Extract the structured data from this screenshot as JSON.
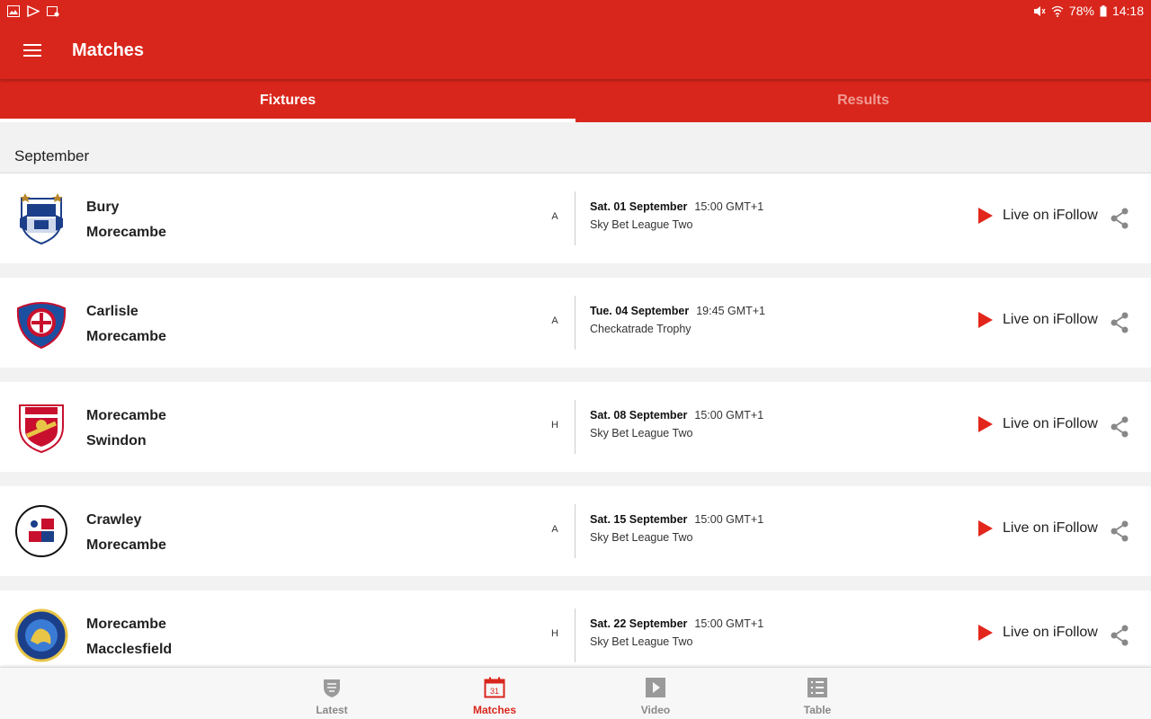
{
  "status_bar": {
    "battery": "78%",
    "time": "14:18"
  },
  "app_bar": {
    "title": "Matches"
  },
  "tabs": [
    {
      "label": "Fixtures",
      "active": true
    },
    {
      "label": "Results",
      "active": false
    }
  ],
  "month": "September",
  "fixtures": [
    {
      "home": "Bury",
      "away": "Morecambe",
      "venue": "A",
      "date": "Sat. 01 September",
      "time": "15:00 GMT+1",
      "competition": "Sky Bet League Two",
      "live_label": "Live on iFollow",
      "crest_icon": "bury-crest-icon"
    },
    {
      "home": "Carlisle",
      "away": "Morecambe",
      "venue": "A",
      "date": "Tue. 04 September",
      "time": "19:45 GMT+1",
      "competition": "Checkatrade Trophy",
      "live_label": "Live on iFollow",
      "crest_icon": "carlisle-crest-icon"
    },
    {
      "home": "Morecambe",
      "away": "Swindon",
      "venue": "H",
      "date": "Sat. 08 September",
      "time": "15:00 GMT+1",
      "competition": "Sky Bet League Two",
      "live_label": "Live on iFollow",
      "crest_icon": "swindon-crest-icon"
    },
    {
      "home": "Crawley",
      "away": "Morecambe",
      "venue": "A",
      "date": "Sat. 15 September",
      "time": "15:00 GMT+1",
      "competition": "Sky Bet League Two",
      "live_label": "Live on iFollow",
      "crest_icon": "crawley-crest-icon"
    },
    {
      "home": "Morecambe",
      "away": "Macclesfield",
      "venue": "H",
      "date": "Sat. 22 September",
      "time": "15:00 GMT+1",
      "competition": "Sky Bet League Two",
      "live_label": "Live on iFollow",
      "crest_icon": "macclesfield-crest-icon"
    }
  ],
  "bottom_nav": [
    {
      "label": "Latest",
      "icon": "shield-icon",
      "active": false
    },
    {
      "label": "Matches",
      "icon": "calendar-icon",
      "calendar_day": "31",
      "active": true
    },
    {
      "label": "Video",
      "icon": "video-play-icon",
      "active": false
    },
    {
      "label": "Table",
      "icon": "table-list-icon",
      "active": false
    }
  ],
  "colors": {
    "brand_red": "#d9261c",
    "play_red": "#e3261c"
  }
}
